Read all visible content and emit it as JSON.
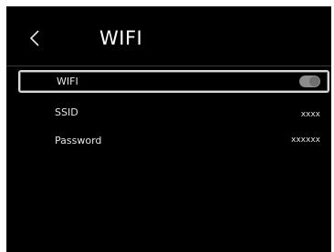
{
  "header": {
    "title": "WIFI",
    "back_icon": "chevron-left-icon"
  },
  "settings": {
    "wifi": {
      "label": "WIFI",
      "enabled": false
    },
    "ssid": {
      "label": "SSID",
      "value": "xxxx"
    },
    "password": {
      "label": "Password",
      "value": "xxxxxx"
    }
  },
  "colors": {
    "background": "#000000",
    "text": "#f2f2f2",
    "selection_border": "#d8d8d8",
    "toggle_track": "#8c8c8c"
  }
}
